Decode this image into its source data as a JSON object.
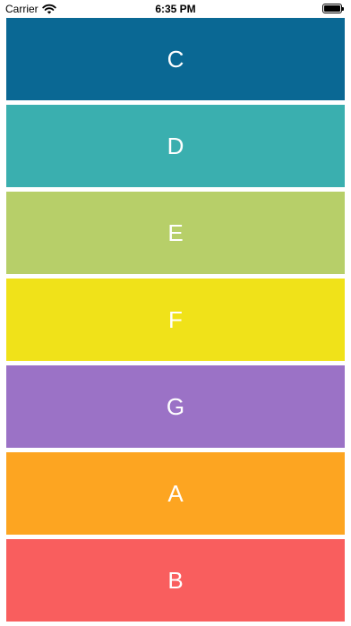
{
  "status_bar": {
    "carrier": "Carrier",
    "time": "6:35 PM"
  },
  "notes": [
    {
      "label": "C",
      "color": "#0A6894"
    },
    {
      "label": "D",
      "color": "#3AAFAF"
    },
    {
      "label": "E",
      "color": "#B7CF69"
    },
    {
      "label": "F",
      "color": "#F0E219"
    },
    {
      "label": "G",
      "color": "#9B72C6"
    },
    {
      "label": "A",
      "color": "#FDA521"
    },
    {
      "label": "B",
      "color": "#F95E5E"
    }
  ]
}
